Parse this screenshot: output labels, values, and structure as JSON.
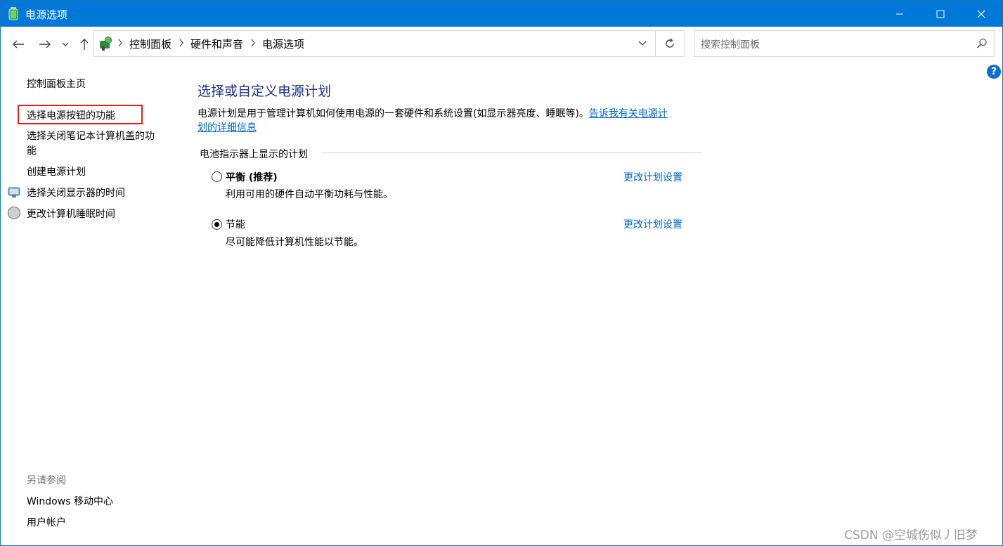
{
  "window": {
    "title": "电源选项",
    "accent_color": "#0078d7",
    "controls": [
      "minimize-icon",
      "maximize-icon",
      "close-icon"
    ]
  },
  "navigation": {
    "back_icon": "arrow-left-icon",
    "forward_icon": "arrow-right-icon",
    "recent_icon": "chevron-down-icon",
    "up_icon": "arrow-up-icon"
  },
  "address_bar": {
    "icon": "control-panel-icon",
    "breadcrumbs": [
      "控制面板",
      "硬件和声音",
      "电源选项"
    ],
    "refresh_icon": "refresh-icon"
  },
  "search": {
    "placeholder": "搜索控制面板",
    "icon": "search-icon"
  },
  "help": {
    "label": "?"
  },
  "sidebar": {
    "home": "控制面板主页",
    "items": [
      {
        "label": "选择电源按钮的功能",
        "highlighted": true
      },
      {
        "label_line1": "选择关闭笔记本计算机盖的功",
        "label_line2": "能"
      },
      {
        "label": "创建电源计划"
      },
      {
        "label": "选择关闭显示器的时间",
        "icon": "monitor-shield-icon"
      },
      {
        "label": "更改计算机睡眠时间",
        "icon": "moon-shield-icon"
      }
    ],
    "see_also": {
      "heading": "另请参阅",
      "links": [
        "Windows 移动中心",
        "用户帐户"
      ]
    }
  },
  "main": {
    "heading": "选择或自定义电源计划",
    "description": "电源计划是用于管理计算机如何使用电源的一套硬件和系统设置(如显示器亮度、睡眠等)。",
    "description_link_line1": "告诉我有关电源计",
    "description_link_line2": "划的详细信息",
    "group_label": "电池指示器上显示的计划",
    "plans": [
      {
        "name": "平衡 (推荐)",
        "description": "利用可用的硬件自动平衡功耗与性能。",
        "selected": false,
        "link": "更改计划设置"
      },
      {
        "name": "节能",
        "description": "尽可能降低计算机性能以节能。",
        "selected": true,
        "link": "更改计划设置"
      }
    ]
  },
  "watermark": "CSDN @空城伤似丿旧梦"
}
